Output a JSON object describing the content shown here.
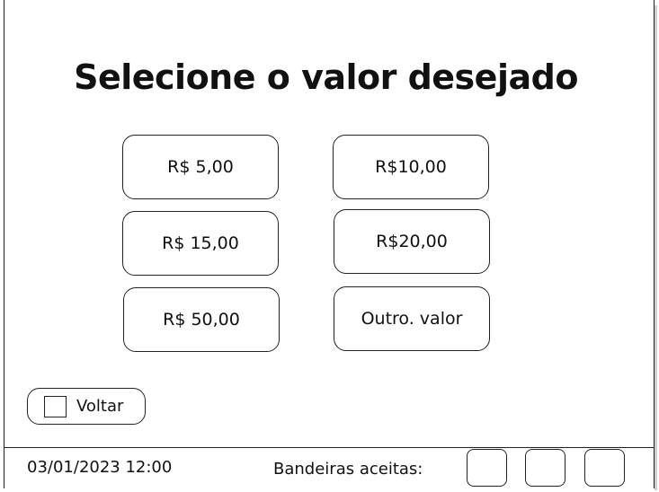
{
  "title": "Selecione o valor desejado",
  "options": [
    {
      "label": "R$ 5,00"
    },
    {
      "label": "R$10,00"
    },
    {
      "label": "R$ 15,00"
    },
    {
      "label": "R$20,00"
    },
    {
      "label": "R$ 50,00"
    },
    {
      "label": "Outro. valor"
    }
  ],
  "back": {
    "label": "Voltar"
  },
  "footer": {
    "datetime": "03/01/2023 12:00",
    "flags_label": "Bandeiras aceitas:",
    "flag_slots": 3
  }
}
